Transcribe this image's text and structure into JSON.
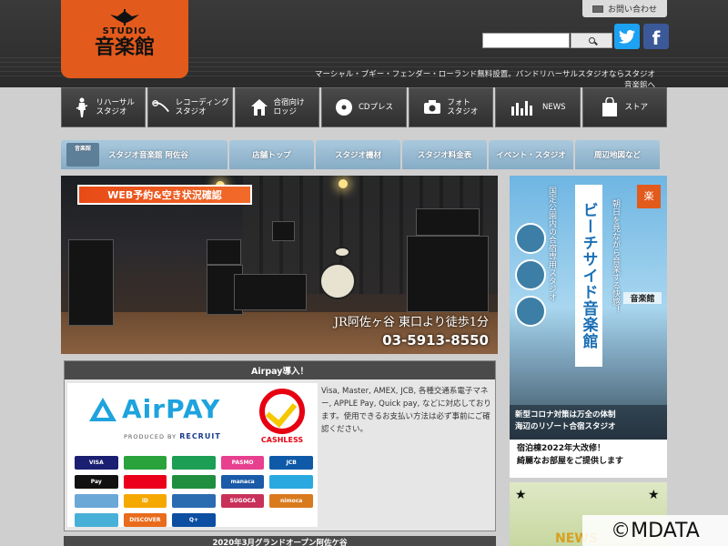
{
  "header": {
    "logo_studio": "STUDIO",
    "logo_name": "音楽館",
    "contact_label": "お問い合わせ",
    "search_placeholder": "",
    "tagline": "マーシャル・ブギー・フェンダー・ローランド無料設置。バンドリハーサルスタジオならスタジオ音楽館へ"
  },
  "nav": {
    "items": [
      {
        "label": "リハーサル\nスタジオ",
        "icon": "guitarist-icon"
      },
      {
        "label": "レコーディング\nスタジオ",
        "icon": "microphone-icon"
      },
      {
        "label": "合宿向け\nロッジ",
        "icon": "lodge-icon"
      },
      {
        "label": "CDプレス",
        "icon": "cd-icon"
      },
      {
        "label": "フォト\nスタジオ",
        "icon": "camera-icon"
      },
      {
        "label": "NEWS",
        "icon": "equalizer-icon"
      },
      {
        "label": "ストア",
        "icon": "shopping-bag-icon"
      }
    ]
  },
  "tabs": {
    "first": "スタジオ音楽館 阿佐谷",
    "items": [
      "店舗トップ",
      "スタジオ機材",
      "スタジオ料金表",
      "イベント・スタジオ",
      "周辺地図など"
    ]
  },
  "hero": {
    "banner": "WEB予約&空き状況確認",
    "access": "JR阿佐ヶ谷 東口より徒歩1分",
    "phone": "03-5913-8550"
  },
  "airpay": {
    "title": "Airpay導入！",
    "logo_text": "AirPAY",
    "produced_by": "PRODUCED BY",
    "recruit": "RECRUIT",
    "cashless": "CASHLESS",
    "description": "Visa, Master, AMEX, JCB, 各種交通系電子マネー, APPLE Pay, Quick pay, などに対応しております。使用できるお支払い方法は必ず事前にご確認ください。",
    "brands": [
      "VISA",
      "",
      "",
      "PASMO",
      "JCB",
      "Pay",
      "",
      "",
      "manaca",
      "",
      "",
      "iD",
      "",
      "SUGOCA",
      "nimoca",
      "",
      "DISCOVER",
      "Q+"
    ],
    "brand_colors": [
      "#1a1f71",
      "#2aa33d",
      "#1d9e55",
      "#e7408f",
      "#0f5aa8",
      "#111111",
      "#eb001b",
      "#1f8f3f",
      "#1b5aa8",
      "#2aa9e0",
      "#6aa8d8",
      "#f5a800",
      "#2b6cb0",
      "#c8325a",
      "#d97a1f",
      "#47b0d8",
      "#e96b1b",
      "#0b4ea2"
    ]
  },
  "bottom_bar": "2020年3月グランドオープン阿佐ケ谷",
  "side_ad": {
    "title": "ビーチサイド音楽館",
    "sub1": "国定公園内の合宿専用スタジオ",
    "sub2": "朝日を見ながら音楽する快感！",
    "logo_badge": "楽",
    "small_logo": "音楽館",
    "covid_line1": "新型コロナ対策は万全の体制",
    "covid_line2": "海辺のリゾート合宿スタジオ",
    "renew_line1": "宿泊棟2022年大改修！",
    "renew_line2": "綺麗なお部屋をご提供します"
  },
  "side_news": {
    "label": "NEWS"
  },
  "watermark": "©MDATA",
  "colors": {
    "logo_orange": "#e25a1c",
    "tab_blue": "#86acc6",
    "nav_dark": "#2f2f2f",
    "airpay_blue": "#1ea3de",
    "twitter": "#1da1f2",
    "facebook": "#3b5998"
  }
}
